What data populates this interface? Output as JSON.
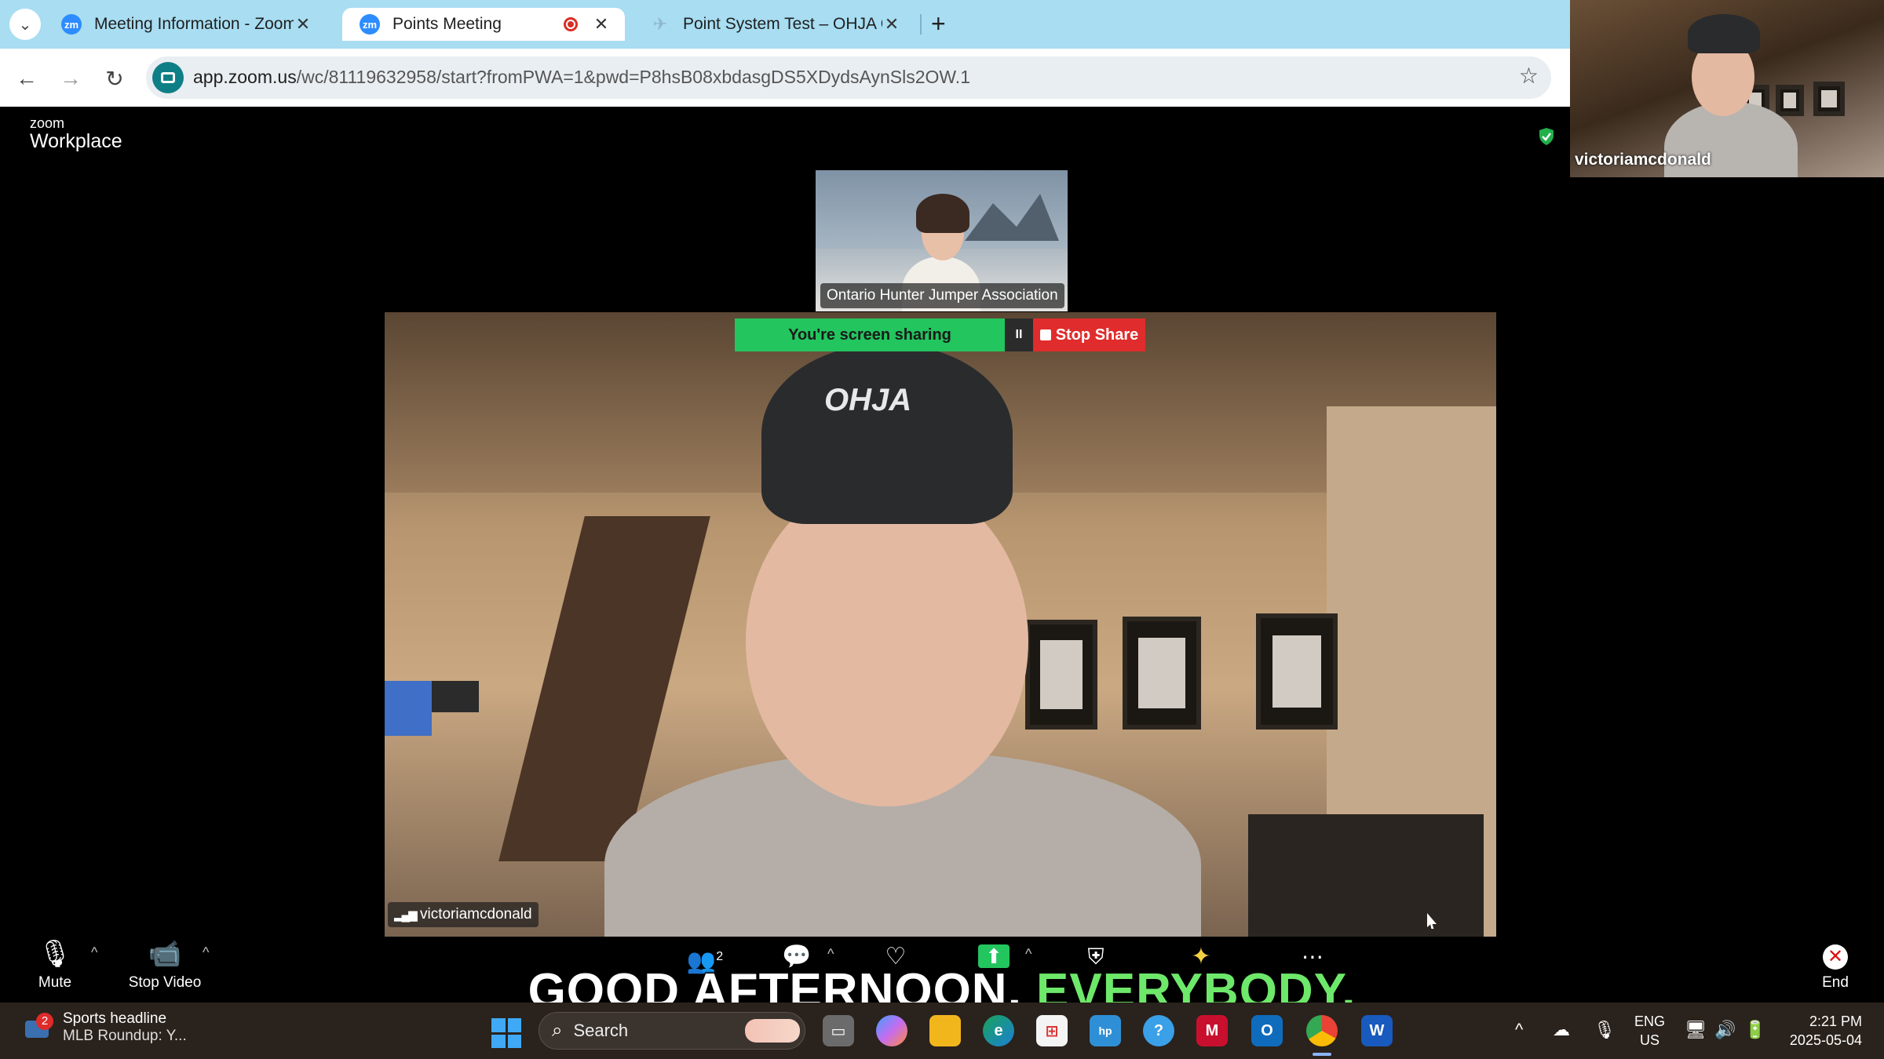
{
  "browser": {
    "tabs": [
      {
        "label": "Meeting Information - Zoom",
        "favicon": "zm"
      },
      {
        "label": "Points Meeting",
        "favicon": "zm"
      },
      {
        "label": "Point System Test – OHJA Ontar",
        "favicon": "plane-icon"
      }
    ],
    "url_host": "app.zoom.us",
    "url_path": "/wc/81119632958/start?fromPWA=1&pwd=P8hsB08xbdasgDS5XDydsAynSls2OW.1"
  },
  "zoom": {
    "logo_small": "zoom",
    "logo_big": "Workplace",
    "self_name": "victoriamcdonald",
    "participant_name": "Ontario Hunter Jumper Association",
    "speaker_name": "victoriamcdonald",
    "share_status": "You're screen sharing",
    "pause_label": "II",
    "stop_share_label": "Stop Share",
    "toolbar": {
      "mute": "Mute",
      "stop_video": "Stop Video",
      "participants_count": "2",
      "end": "End"
    },
    "caption_main": "GOOD AFTERNOON,",
    "caption_accent": "EVERYBODY."
  },
  "taskbar": {
    "news_badge": "2",
    "news_title": "Sports headline",
    "news_sub": "MLB Roundup: Y...",
    "search_placeholder": "Search",
    "lang_1": "ENG",
    "lang_2": "US",
    "time": "2:21 PM",
    "date": "2025-05-04"
  },
  "colors": {
    "tab_strip": "#a8ddf2",
    "share_green": "#23c55e",
    "stop_red": "#e02c2c",
    "caption_accent": "#6ee86a"
  }
}
